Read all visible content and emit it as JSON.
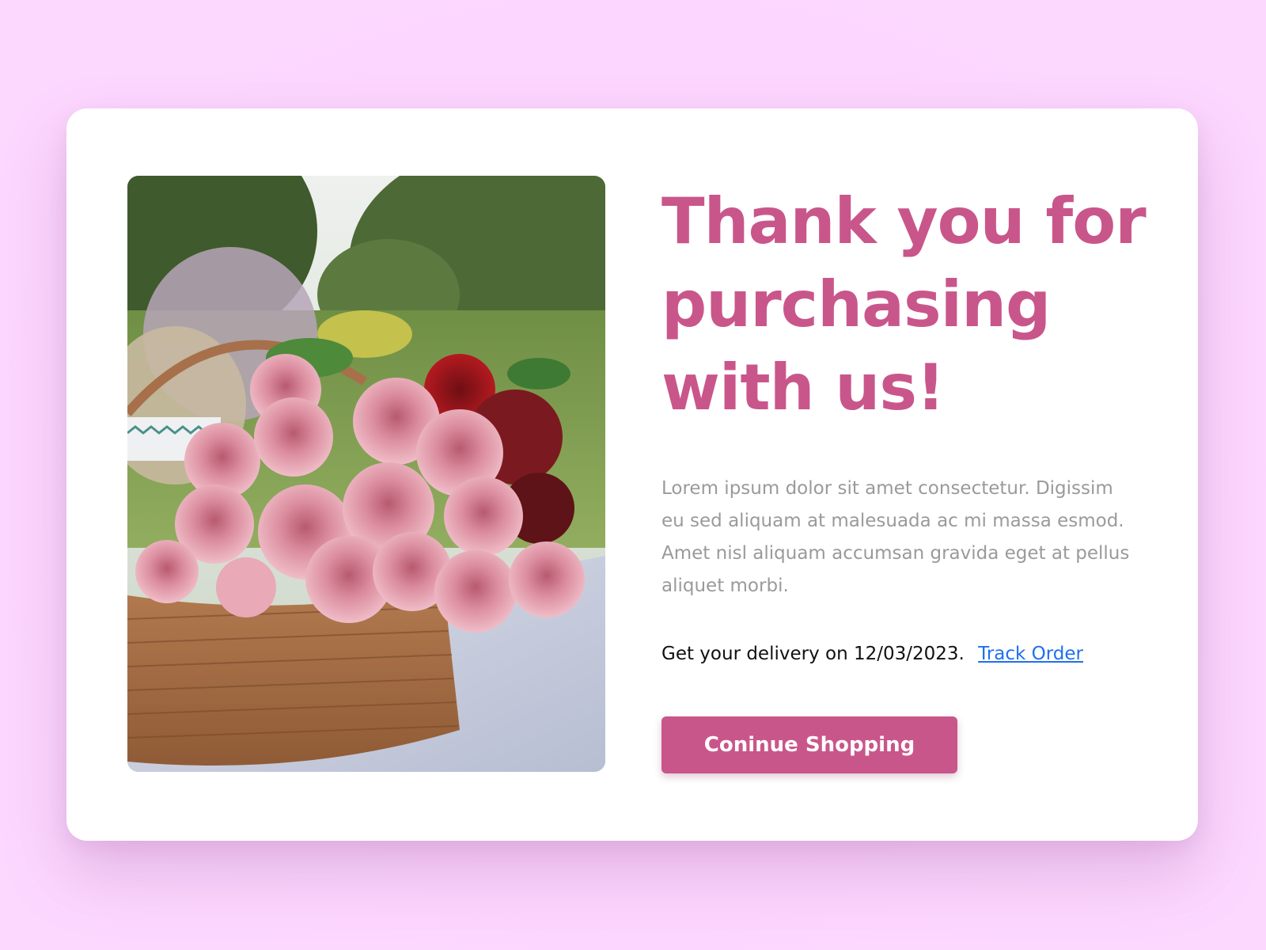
{
  "headline": "Thank you for\npurchasing\nwith us!",
  "body": "Lorem ipsum dolor sit amet consectetur. Digissim eu sed aliquam at malesuada ac mi massa esmod. Amet nisl aliquam accumsan gravida eget at pellus aliquet morbi.",
  "delivery": {
    "text": "Get your delivery on 12/03/2023.",
    "link_label": "Track Order"
  },
  "cta": {
    "label": "Coninue Shopping"
  },
  "colors": {
    "background": "#fcd7fd",
    "accent": "#c9568a",
    "link": "#1f6ff0",
    "body_text": "#9a9a9a"
  },
  "image": {
    "icon": "flower-basket-photo"
  }
}
